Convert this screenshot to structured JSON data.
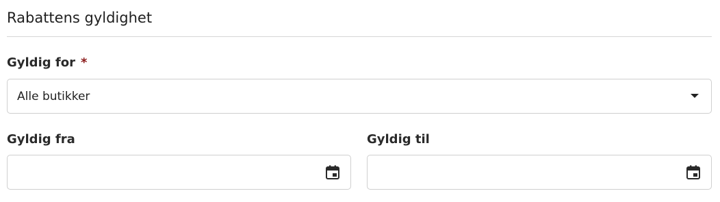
{
  "section": {
    "title": "Rabattens gyldighet"
  },
  "valid_for": {
    "label": "Gyldig for",
    "required_marker": "*",
    "selected": "Alle butikker"
  },
  "valid_from": {
    "label": "Gyldig fra",
    "value": ""
  },
  "valid_to": {
    "label": "Gyldig til",
    "value": ""
  },
  "icons": {
    "dropdown": "chevron-down-icon",
    "date_picker": "calendar-icon"
  },
  "colors": {
    "required": "#8b1a1a",
    "border": "#cfcfcf",
    "divider": "#d6d6d6"
  }
}
